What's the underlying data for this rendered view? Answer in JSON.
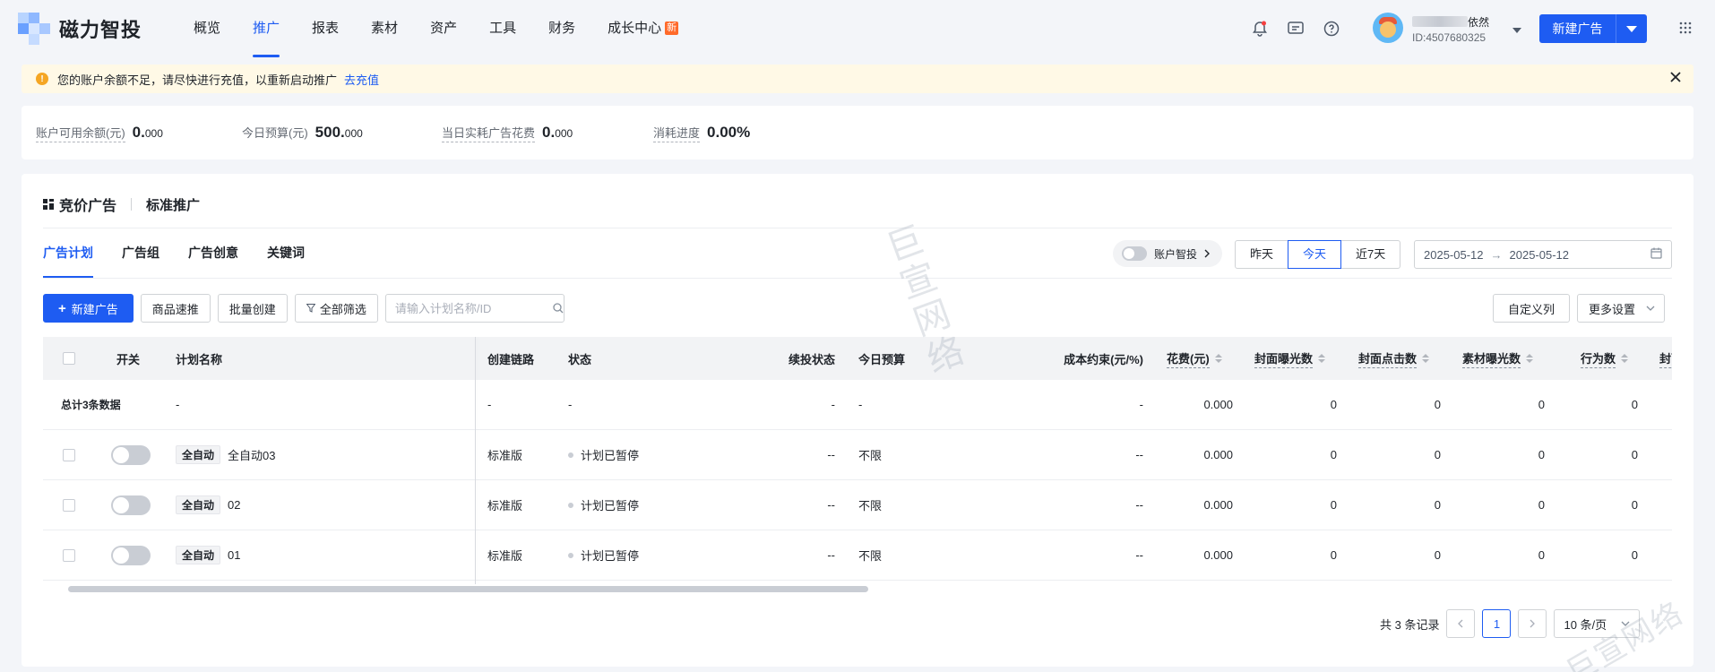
{
  "brand": {
    "name": "磁力智投"
  },
  "nav": [
    {
      "label": "概览"
    },
    {
      "label": "推广",
      "active": true
    },
    {
      "label": "报表"
    },
    {
      "label": "素材"
    },
    {
      "label": "资产"
    },
    {
      "label": "工具"
    },
    {
      "label": "财务"
    },
    {
      "label": "成长中心",
      "badge": "新"
    }
  ],
  "user": {
    "name_suffix": "依然",
    "id": "ID:4507680325"
  },
  "header": {
    "new_ad_label": "新建广告"
  },
  "warning": {
    "text": "您的账户余额不足，请尽快进行充值，以重新启动推广",
    "link": "去充值"
  },
  "stats": [
    {
      "label": "账户可用余额(元)",
      "int": "0.",
      "dec": "000"
    },
    {
      "label": "今日预算(元)",
      "int": "500.",
      "dec": "000"
    },
    {
      "label": "当日实耗广告花费",
      "int": "0.",
      "dec": "000"
    },
    {
      "label": "消耗进度",
      "int": "0.00%",
      "dec": ""
    }
  ],
  "panel": {
    "title": "竞价广告",
    "subtitle": "标准推广"
  },
  "tabs": [
    {
      "label": "广告计划",
      "active": true
    },
    {
      "label": "广告组"
    },
    {
      "label": "广告创意"
    },
    {
      "label": "关键词"
    }
  ],
  "smart_toggle": {
    "label": "账户智投"
  },
  "date_segments": [
    {
      "label": "昨天"
    },
    {
      "label": "今天",
      "active": true
    },
    {
      "label": "近7天"
    }
  ],
  "date_range": {
    "start": "2025-05-12",
    "end": "2025-05-12"
  },
  "toolbar": {
    "new_ad": "新建广告",
    "product_push": "商品速推",
    "batch_create": "批量创建",
    "all_filter": "全部筛选",
    "search_placeholder": "请输入计划名称/ID",
    "custom_columns": "自定义列",
    "more_settings": "更多设置"
  },
  "table": {
    "headers": {
      "switch": "开关",
      "name": "计划名称",
      "chain": "创建链路",
      "status": "状态",
      "renew": "续投状态",
      "budget": "今日预算",
      "cost_limit": "成本约束(元/%)",
      "spend": "花费(元)",
      "cover_imp": "封面曝光数",
      "cover_click": "封面点击数",
      "mat_imp": "素材曝光数",
      "actions": "行为数",
      "cover_ctr": "封面点"
    },
    "total": {
      "label": "总计3条数据",
      "name": "-",
      "chain": "-",
      "status": "-",
      "renew": "-",
      "budget": "-",
      "cost_limit": "-",
      "spend": "0.000",
      "cover_imp": "0",
      "cover_click": "0",
      "mat_imp": "0",
      "actions": "0"
    },
    "rows": [
      {
        "tag": "全自动",
        "name": "全自动03",
        "chain": "标准版",
        "status": "计划已暂停",
        "renew": "--",
        "budget": "不限",
        "cost_limit": "--",
        "spend": "0.000",
        "cover_imp": "0",
        "cover_click": "0",
        "mat_imp": "0",
        "actions": "0"
      },
      {
        "tag": "全自动",
        "name": "02",
        "chain": "标准版",
        "status": "计划已暂停",
        "renew": "--",
        "budget": "不限",
        "cost_limit": "--",
        "spend": "0.000",
        "cover_imp": "0",
        "cover_click": "0",
        "mat_imp": "0",
        "actions": "0"
      },
      {
        "tag": "全自动",
        "name": "01",
        "chain": "标准版",
        "status": "计划已暂停",
        "renew": "--",
        "budget": "不限",
        "cost_limit": "--",
        "spend": "0.000",
        "cover_imp": "0",
        "cover_click": "0",
        "mat_imp": "0",
        "actions": "0"
      }
    ]
  },
  "pagination": {
    "total_text": "共 3 条记录",
    "current": "1",
    "page_size": "10 条/页"
  },
  "watermark": {
    "text": "巨宣网络"
  }
}
